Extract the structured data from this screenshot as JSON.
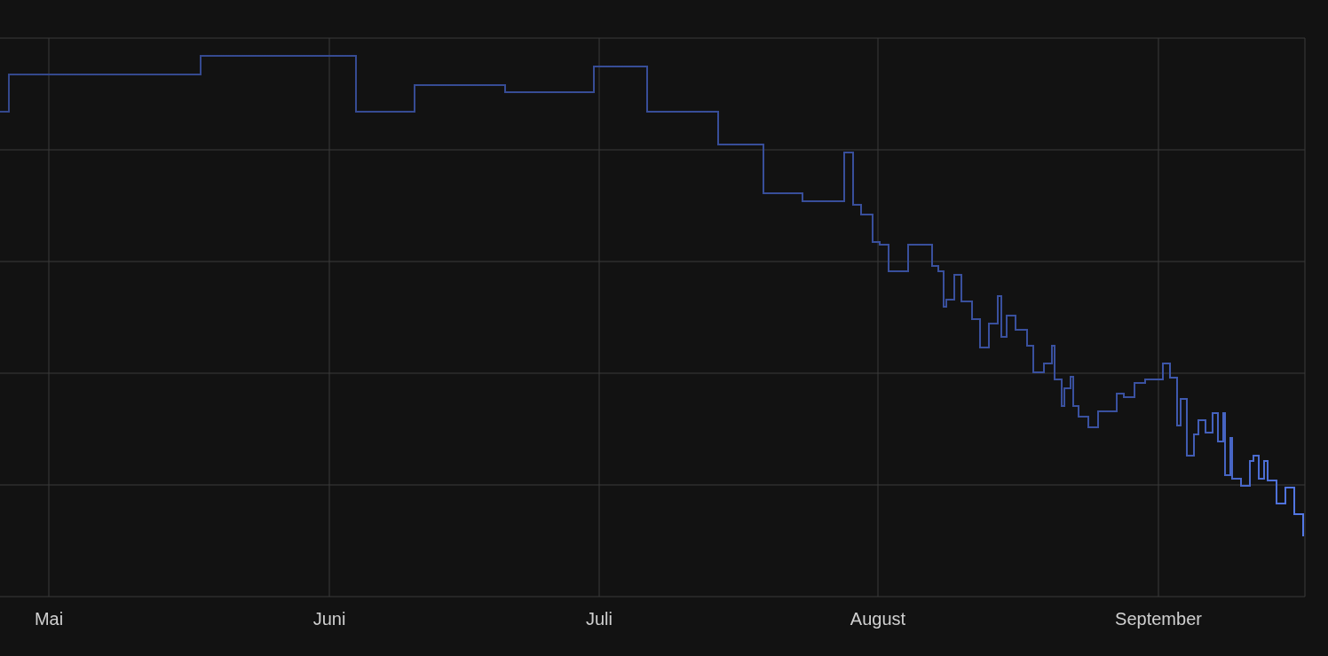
{
  "x_axis": {
    "labels": [
      "Mai",
      "Juni",
      "Juli",
      "August",
      "September"
    ]
  }
}
